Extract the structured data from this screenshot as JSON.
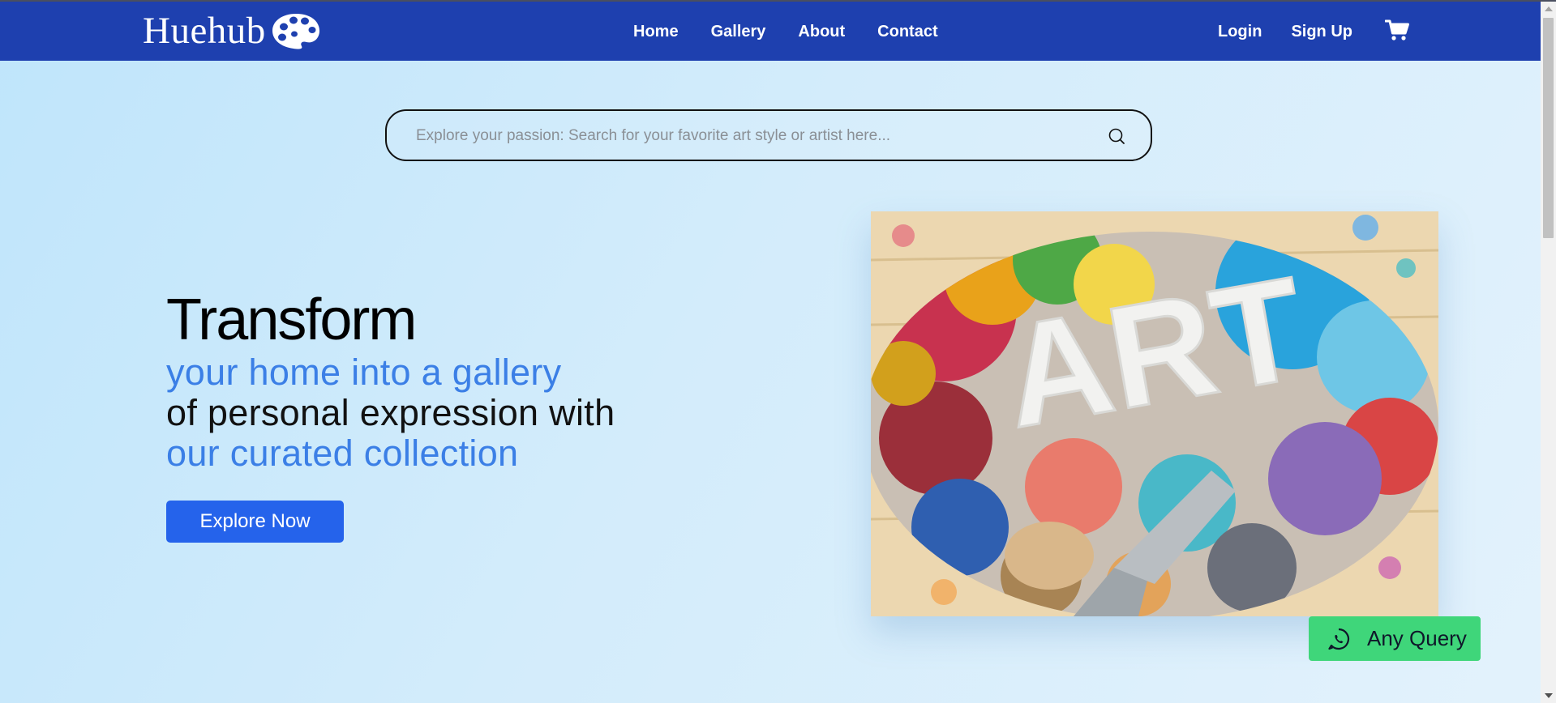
{
  "brand": {
    "name": "Huehub",
    "icon": "palette-icon"
  },
  "nav": {
    "links": [
      {
        "label": "Home"
      },
      {
        "label": "Gallery"
      },
      {
        "label": "About"
      },
      {
        "label": "Contact"
      }
    ],
    "login": "Login",
    "signup": "Sign Up",
    "cart_icon": "cart-icon"
  },
  "search": {
    "placeholder": "Explore your passion: Search for your favorite art style or artist here...",
    "icon": "search-icon"
  },
  "hero": {
    "title": "Transform",
    "line1": "your home into a gallery",
    "line2": "of personal expression with",
    "line3": "our curated collection",
    "cta": "Explore Now"
  },
  "artwork": {
    "painted_text": "ART"
  },
  "query": {
    "label": "Any Query",
    "icon": "whatsapp-icon"
  },
  "colors": {
    "navbar": "#1e40af",
    "accent_blue": "#3b7fe6",
    "cta": "#2563eb",
    "query_green": "#3fd67a"
  }
}
